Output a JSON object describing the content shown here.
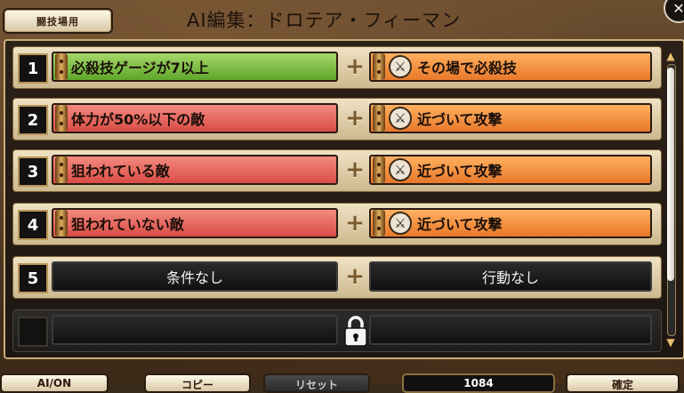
{
  "header": {
    "tag_label": "闘技場用",
    "title": "AI編集：ドロテア・フィーマン",
    "close_glyph": "✕"
  },
  "rows": [
    {
      "number": "1",
      "condition": "必殺技ゲージが7以上",
      "condition_color": "green",
      "action": "その場で必殺技",
      "action_icon": "crossed-swords-icon"
    },
    {
      "number": "2",
      "condition": "体力が50%以下の敵",
      "condition_color": "red",
      "action": "近づいて攻撃",
      "action_icon": "crossed-swords-icon"
    },
    {
      "number": "3",
      "condition": "狙われている敵",
      "condition_color": "red",
      "action": "近づいて攻撃",
      "action_icon": "crossed-swords-icon"
    },
    {
      "number": "4",
      "condition": "狙われていない敵",
      "condition_color": "red",
      "action": "近づいて攻撃",
      "action_icon": "crossed-swords-icon"
    },
    {
      "number": "5",
      "condition": "条件なし",
      "condition_color": "empty",
      "action": "行動なし",
      "action_icon": ""
    }
  ],
  "locked_row": {
    "icon": "padlock-icon"
  },
  "plus_glyph": "+",
  "bottom": {
    "ai_on": "AI/ON",
    "copy": "コピー",
    "reset": "リセット",
    "cost": "1084",
    "confirm": "確定"
  },
  "colors": {
    "condition_green": "#5ea62a",
    "condition_red": "#d94c45",
    "action_orange": "#e8782a",
    "frame_gold": "#c9ad7b"
  }
}
